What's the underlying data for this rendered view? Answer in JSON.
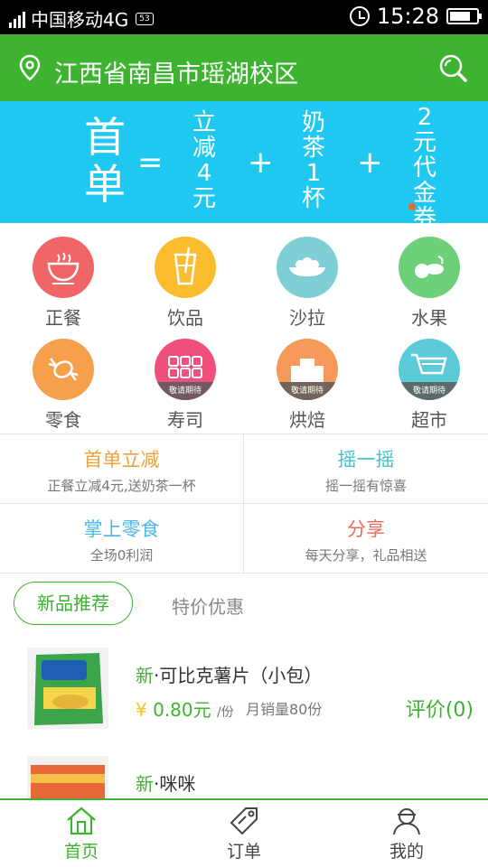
{
  "status_bar": {
    "carrier": "中国移动4G",
    "hd_badge": "53",
    "time": "15:28"
  },
  "header": {
    "location": "江西省南昌市瑶湖校区",
    "icons": [
      "location-pin-icon",
      "search-icon"
    ]
  },
  "banner": {
    "headline": "首单",
    "equals": "=",
    "plus": "+",
    "item1": "立减4元",
    "item2": "奶茶1杯",
    "item3": "2元代金券"
  },
  "categories": [
    {
      "label": "正餐",
      "color": "#f06565",
      "icon": "bowl-icon"
    },
    {
      "label": "饮品",
      "color": "#fbbd2e",
      "icon": "drink-icon"
    },
    {
      "label": "沙拉",
      "color": "#7ecfd6",
      "icon": "salad-icon"
    },
    {
      "label": "水果",
      "color": "#6ed07a",
      "icon": "fruit-icon"
    },
    {
      "label": "零食",
      "color": "#f6a04c",
      "icon": "candy-icon"
    },
    {
      "label": "寿司",
      "color": "#f0507c",
      "icon": "sushi-icon",
      "badge": "敬请期待"
    },
    {
      "label": "烘焙",
      "color": "#f59a58",
      "icon": "cake-icon",
      "badge": "敬请期待"
    },
    {
      "label": "超市",
      "color": "#5ccbd8",
      "icon": "cart-icon",
      "badge": "敬请期待"
    }
  ],
  "promos": [
    {
      "title": "首单立减",
      "subtitle": "正餐立减4元,送奶茶一杯",
      "color": "#f0a23c"
    },
    {
      "title": "摇一摇",
      "subtitle": "摇一摇有惊喜",
      "color": "#3fc3d4"
    },
    {
      "title": "掌上零食",
      "subtitle": "全场0利润",
      "color": "#4ab8e8"
    },
    {
      "title": "分享",
      "subtitle": "每天分享，礼品相送",
      "color": "#f06a5a"
    }
  ],
  "tabs": {
    "active": "新品推荐",
    "other": "特价优惠"
  },
  "products": [
    {
      "new_tag": "新",
      "name": "·可比克薯片（小包）",
      "price": "0.80元",
      "unit": "/份",
      "sales": "月销量80份",
      "review": "评价(0)"
    },
    {
      "new_tag": "新",
      "name": "·咪咪"
    }
  ],
  "bottom_nav": [
    {
      "label": "首页",
      "icon": "home-icon",
      "active": true
    },
    {
      "label": "订单",
      "icon": "tag-icon"
    },
    {
      "label": "我的",
      "icon": "user-icon"
    }
  ],
  "colors": {
    "brand_green": "#3db32f",
    "banner_blue": "#1fc8f0"
  }
}
